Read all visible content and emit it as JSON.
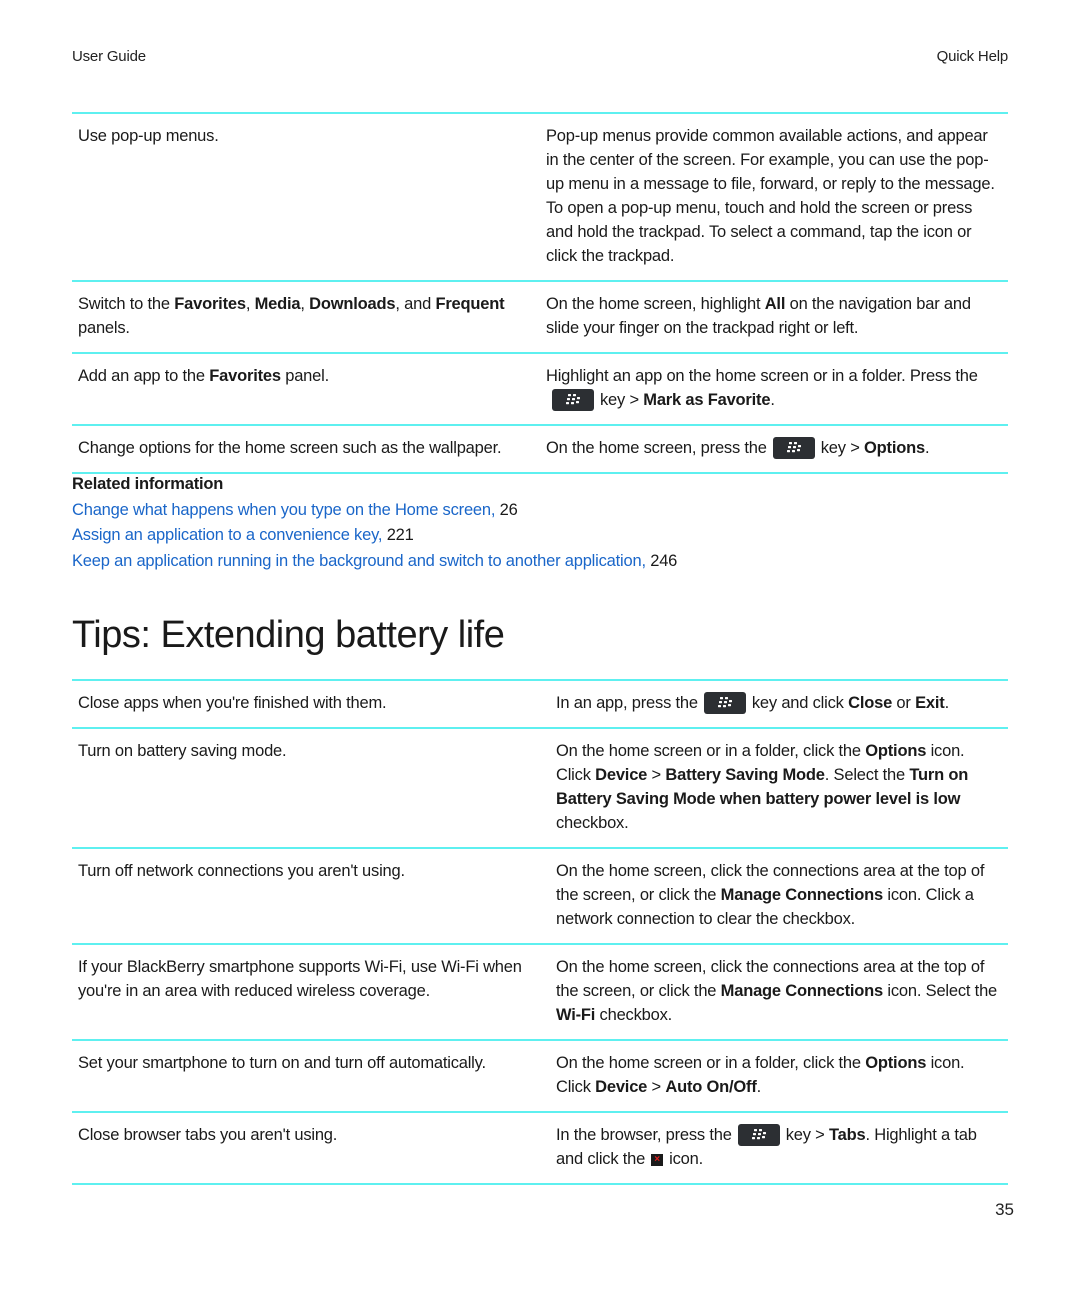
{
  "header": {
    "left": "User Guide",
    "right": "Quick Help"
  },
  "table1": {
    "rows": [
      {
        "task": [
          {
            "t": "Use pop-up menus."
          }
        ],
        "how": [
          {
            "t": "Pop-up menus provide common available actions, and appear in the center of the screen. For example, you can use the pop-up menu in a message to file, forward, or reply to the message. To open a pop-up menu, touch and hold the screen or press and hold the trackpad. To select a command, tap the icon or click the trackpad."
          }
        ]
      },
      {
        "task": [
          {
            "t": "Switch to the "
          },
          {
            "t": "Favorites",
            "b": true
          },
          {
            "t": ", "
          },
          {
            "t": "Media",
            "b": true
          },
          {
            "t": ", "
          },
          {
            "t": "Downloads",
            "b": true
          },
          {
            "t": ", and "
          },
          {
            "t": "Frequent",
            "b": true
          },
          {
            "t": " panels."
          }
        ],
        "how": [
          {
            "t": "On the home screen, highlight "
          },
          {
            "t": "All",
            "b": true
          },
          {
            "t": " on the navigation bar and slide your finger on the trackpad right or left."
          }
        ]
      },
      {
        "task": [
          {
            "t": "Add an app to the "
          },
          {
            "t": "Favorites",
            "b": true
          },
          {
            "t": " panel."
          }
        ],
        "how": [
          {
            "t": "Highlight an app on the home screen or in a folder. Press the"
          },
          {
            "icon": "blackberry-menu-key-icon"
          },
          {
            "t": "key > "
          },
          {
            "t": "Mark as Favorite",
            "b": true
          },
          {
            "t": "."
          }
        ]
      },
      {
        "task": [
          {
            "t": "Change options for the home screen such as the wallpaper."
          }
        ],
        "how": [
          {
            "t": "On the home screen, press the"
          },
          {
            "icon": "blackberry-menu-key-icon"
          },
          {
            "t": "key > "
          },
          {
            "t": "Options",
            "b": true
          },
          {
            "t": "."
          }
        ]
      }
    ]
  },
  "related": {
    "title": "Related information",
    "links": [
      {
        "label": "Change what happens when you type on the Home screen,",
        "page": "26"
      },
      {
        "label": "Assign an application to a convenience key,",
        "page": "221"
      },
      {
        "label": "Keep an application running in the background and switch to another application,",
        "page": "246"
      }
    ]
  },
  "section": {
    "title": "Tips: Extending battery life"
  },
  "table2": {
    "rows": [
      {
        "task": [
          {
            "t": "Close apps when you're finished with them."
          }
        ],
        "how": [
          {
            "t": "In an app, press the"
          },
          {
            "icon": "blackberry-menu-key-icon"
          },
          {
            "t": "key and click "
          },
          {
            "t": "Close",
            "b": true
          },
          {
            "t": " or "
          },
          {
            "t": "Exit",
            "b": true
          },
          {
            "t": "."
          }
        ]
      },
      {
        "task": [
          {
            "t": "Turn on battery saving mode."
          }
        ],
        "how": [
          {
            "t": "On the home screen or in a folder, click the "
          },
          {
            "t": "Options",
            "b": true
          },
          {
            "t": " icon. Click "
          },
          {
            "t": "Device",
            "b": true
          },
          {
            "t": " > "
          },
          {
            "t": "Battery Saving Mode",
            "b": true
          },
          {
            "t": ". Select the "
          },
          {
            "t": "Turn on Battery Saving Mode when battery power level is low",
            "b": true
          },
          {
            "t": " checkbox."
          }
        ]
      },
      {
        "task": [
          {
            "t": "Turn off network connections you aren't using."
          }
        ],
        "how": [
          {
            "t": "On the home screen, click the connections area at the top of the screen, or click the "
          },
          {
            "t": "Manage Connections",
            "b": true
          },
          {
            "t": " icon. Click a network connection to clear the checkbox."
          }
        ]
      },
      {
        "task": [
          {
            "t": "If your BlackBerry smartphone supports Wi-Fi, use Wi-Fi when you're in an area with reduced wireless coverage."
          }
        ],
        "how": [
          {
            "t": "On the home screen, click the connections area at the top of the screen, or click the "
          },
          {
            "t": "Manage Connections",
            "b": true
          },
          {
            "t": " icon. Select the "
          },
          {
            "t": "Wi-Fi",
            "b": true
          },
          {
            "t": " checkbox."
          }
        ]
      },
      {
        "task": [
          {
            "t": "Set your smartphone to turn on and turn off automatically."
          }
        ],
        "how": [
          {
            "t": "On the home screen or in a folder, click the "
          },
          {
            "t": "Options",
            "b": true
          },
          {
            "t": " icon. Click "
          },
          {
            "t": "Device",
            "b": true
          },
          {
            "t": " > "
          },
          {
            "t": "Auto On/Off",
            "b": true
          },
          {
            "t": "."
          }
        ]
      },
      {
        "task": [
          {
            "t": "Close browser tabs you aren't using."
          }
        ],
        "how": [
          {
            "t": "In the browser, press the"
          },
          {
            "icon": "blackberry-menu-key-icon"
          },
          {
            "t": "key > "
          },
          {
            "t": "Tabs",
            "b": true
          },
          {
            "t": ". Highlight a tab and click the"
          },
          {
            "icon": "close-tab-icon"
          },
          {
            "t": "icon."
          }
        ]
      }
    ]
  },
  "footer": {
    "page_number": "35"
  },
  "colors": {
    "rule": "#5ef0f0",
    "link": "#1a66c9",
    "key_bg": "#2c2f33",
    "close_icon_x": "#e02020"
  }
}
